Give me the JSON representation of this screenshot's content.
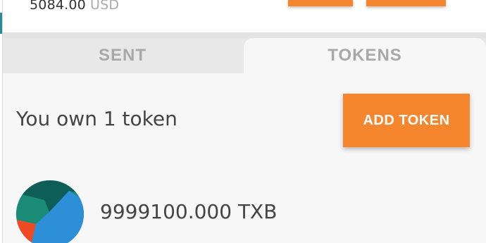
{
  "account": {
    "balance_value": "5084.00",
    "balance_unit": "USD"
  },
  "tabs": [
    {
      "label": "SENT",
      "active": false
    },
    {
      "label": "TOKENS",
      "active": true
    }
  ],
  "tokens": {
    "summary": "You own 1 token",
    "add_button_label": "ADD TOKEN",
    "items": [
      {
        "amount": "9999100.000 TXB",
        "icon": "token-identicon"
      }
    ]
  },
  "colors": {
    "accent": "#f5862e",
    "text": "#444444",
    "muted": "#a8a8a8"
  }
}
